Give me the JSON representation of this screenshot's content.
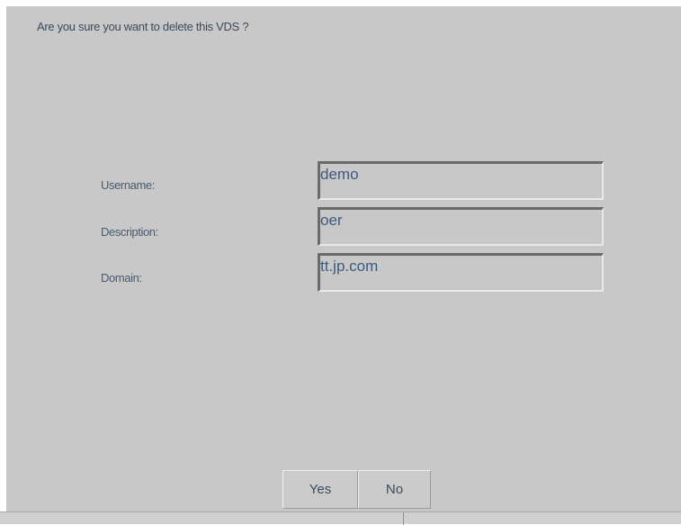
{
  "dialog": {
    "prompt": "Are you sure you want to delete this VDS ?"
  },
  "fields": [
    {
      "label": "Username:",
      "value": "demo"
    },
    {
      "label": "Description:",
      "value": "oer"
    },
    {
      "label": "Domain:",
      "value": "tt.jp.com"
    }
  ],
  "buttons": {
    "yes_label": "Yes",
    "no_label": "No"
  }
}
